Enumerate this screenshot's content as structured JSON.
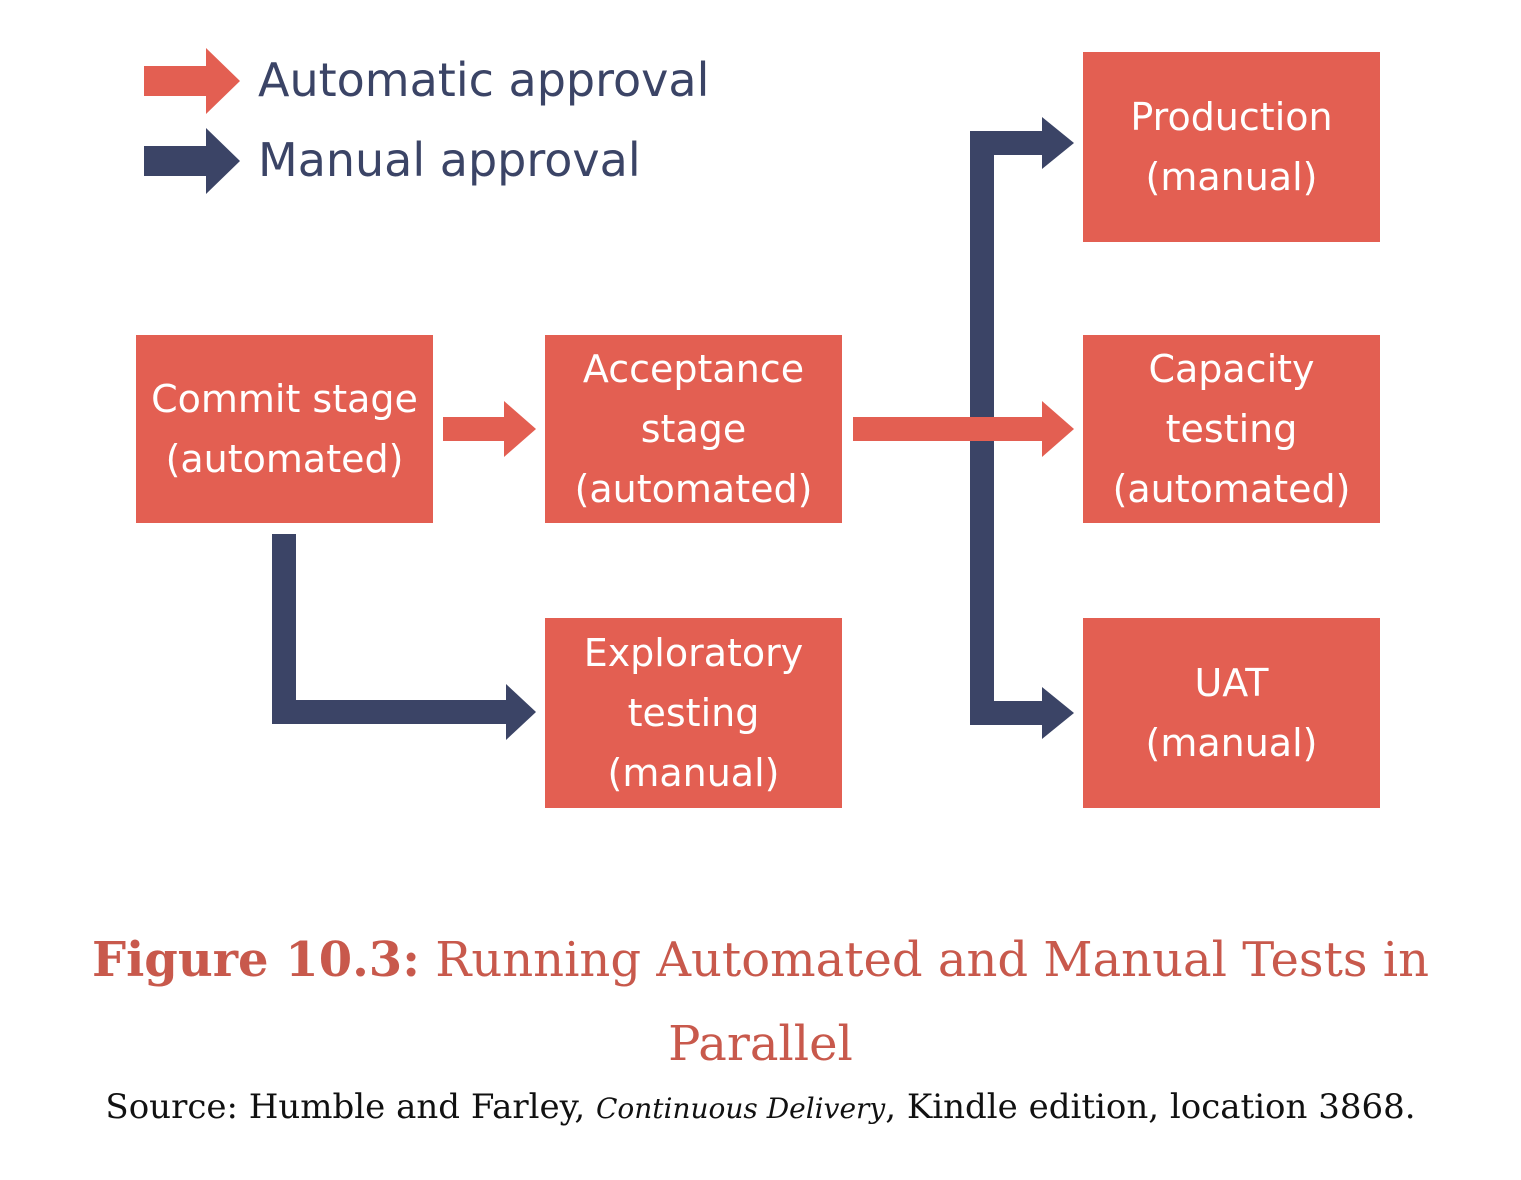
{
  "legend": {
    "automatic_label": "Automatic approval",
    "manual_label": "Manual approval"
  },
  "colors": {
    "automatic_arrow": "#e35f52",
    "manual_arrow": "#3b4466",
    "box_fill": "#e35f52",
    "box_text": "#ffffff",
    "caption": "#c8594c",
    "source_text": "#111111"
  },
  "boxes": {
    "commit": "Commit stage\n(automated)",
    "acceptance": "Acceptance\nstage\n(automated)",
    "exploratory": "Exploratory\ntesting\n(manual)",
    "production": "Production\n(manual)",
    "capacity": "Capacity\ntesting\n(automated)",
    "uat": "UAT\n(manual)"
  },
  "edges": [
    {
      "from": "Commit stage",
      "to": "Acceptance stage",
      "approval": "automatic"
    },
    {
      "from": "Commit stage",
      "to": "Exploratory testing",
      "approval": "manual"
    },
    {
      "from": "Acceptance stage",
      "to": "Capacity testing",
      "approval": "automatic"
    },
    {
      "from": "Acceptance stage",
      "to": "Production",
      "approval": "manual"
    },
    {
      "from": "Acceptance stage",
      "to": "UAT",
      "approval": "manual"
    }
  ],
  "caption": {
    "figure_number": "Figure 10.3:",
    "title": "Running Automated and Manual Tests in Parallel"
  },
  "source": {
    "prefix": "Source: Humble and Farley, ",
    "book_title": "Continuous Delivery",
    "suffix": ", Kindle edition, location 3868."
  }
}
